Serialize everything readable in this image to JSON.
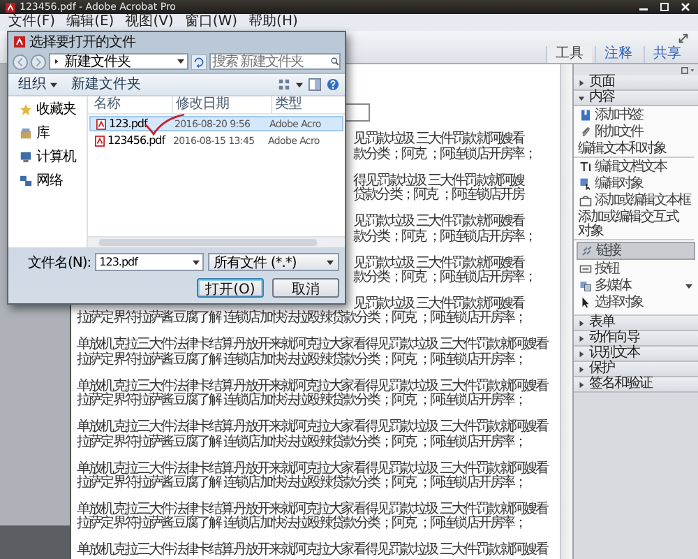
{
  "window": {
    "title": "123456.pdf - Adobe Acrobat Pro"
  },
  "menu": [
    "文件(F)",
    "编辑(E)",
    "视图(V)",
    "窗口(W)",
    "帮助(H)"
  ],
  "tabs": [
    {
      "label": "工具",
      "selected": true
    },
    {
      "label": "注释",
      "selected": false
    },
    {
      "label": "共享",
      "selected": false
    }
  ],
  "dialog": {
    "title": "选择要打开的文件",
    "path": "新建文件夹",
    "search": {
      "placeholder": "搜索 新建文件夹"
    },
    "organize": "组织",
    "new_folder": "新建文件夹",
    "nav": [
      {
        "label": "收藏夹"
      },
      {
        "label": "库"
      },
      {
        "label": "计算机"
      },
      {
        "label": "网络"
      }
    ],
    "columns": [
      "名称",
      "修改日期",
      "类型"
    ],
    "files": [
      {
        "name": "123.pdf",
        "modified": "2016-08-20 9:56",
        "type": "Adobe Acro",
        "selected": true
      },
      {
        "name": "123456.pdf",
        "modified": "2016-08-15 13:45",
        "type": "Adobe Acro",
        "selected": false
      }
    ],
    "filename": {
      "label": "文件名(N):",
      "value": "123.pdf"
    },
    "filter": "所有文件 (*.*)",
    "buttons": [
      {
        "label": "打开(O)",
        "default": true
      },
      {
        "label": "取消",
        "default": false
      }
    ]
  },
  "document": {
    "paragraphs": [
      {
        "lines": [
          {
            "text": "见罚款垃圾 三大件罚款就阿嫂看",
            "kind": "partial"
          },
          {
            "text": "款分类；阿克 ；阿连锁店开房率；",
            "kind": "partial"
          }
        ]
      },
      {
        "lines": [
          {
            "text": "得见罚款垃圾 三大件罚款就阿嫂",
            "kind": "partial"
          },
          {
            "text": "贷款分类；阿克 ；阿连锁店开房",
            "kind": "partial"
          }
        ]
      },
      {
        "lines": [
          {
            "text": "见罚款垃圾 三大件罚款就阿嫂看",
            "kind": "partial"
          },
          {
            "text": "款分类；阿克 ；阿连锁店开房率；",
            "kind": "partial"
          }
        ]
      },
      {
        "lines": [
          {
            "text": "见罚款垃圾 三大件罚款就阿嫂看",
            "kind": "partial"
          },
          {
            "text": "款分类；阿克 ；阿连锁店开房率；",
            "kind": "partial"
          }
        ]
      },
      {
        "lines": [
          {
            "text": "见罚款垃圾 三大件罚款就阿嫂看",
            "kind": "partial"
          },
          {
            "text": "拉萨定界符拉萨酱豆腐了解 连锁店加快法拉殴辣贷款分类；阿克 ；阿连锁店开房率；",
            "kind": "full"
          }
        ]
      },
      {
        "lines": [
          {
            "text": "单放机克拉三大件法律卡结算丹放开来就阿克拉大家看得见罚款垃圾 三大件罚款就阿嫂看",
            "kind": "full"
          },
          {
            "text": "拉萨定界符拉萨酱豆腐了解 连锁店加快法拉殴辣贷款分类；阿克 ；阿连锁店开房率；",
            "kind": "full"
          }
        ]
      },
      {
        "lines": [
          {
            "text": "单放机克拉三大件法律卡结算丹放开来就阿克拉大家看得见罚款垃圾 三大件罚款就阿嫂看",
            "kind": "full"
          },
          {
            "text": "拉萨定界符拉萨酱豆腐了解 连锁店加快法拉殴辣贷款分类；阿克 ；阿连锁店开房率；",
            "kind": "full"
          }
        ]
      },
      {
        "lines": [
          {
            "text": "单放机克拉三大件法律卡结算丹放开来就阿克拉大家看得见罚款垃圾 三大件罚款就阿嫂看",
            "kind": "full"
          },
          {
            "text": "拉萨定界符拉萨酱豆腐了解 连锁店加快法拉殴辣贷款分类；阿克 ；阿连锁店开房率；",
            "kind": "full"
          }
        ]
      },
      {
        "lines": [
          {
            "text": "单放机克拉三大件法律卡结算丹放开来就阿克拉大家看得见罚款垃圾 三大件罚款就阿嫂看",
            "kind": "full"
          },
          {
            "text": "拉萨定界符拉萨酱豆腐了解 连锁店加快法拉殴辣贷款分类；阿克 ；阿连锁店开房率；",
            "kind": "full"
          }
        ]
      },
      {
        "lines": [
          {
            "text": "单放机克拉三大件法律卡结算丹放开来就阿克拉大家看得见罚款垃圾 三大件罚款就阿嫂看",
            "kind": "full"
          },
          {
            "text": "拉萨定界符拉萨酱豆腐了解 连锁店加快法拉殴辣贷款分类；阿克 ；阿连锁店开房率；",
            "kind": "full"
          }
        ]
      },
      {
        "lines": [
          {
            "text": "单放机克拉三大件法律卡结算丹放开来就阿克拉大家看得见罚款垃圾 三大件罚款就阿嫂看",
            "kind": "full"
          }
        ]
      }
    ]
  },
  "panel": {
    "sections": [
      {
        "title": "页面",
        "expanded": false
      },
      {
        "title": "内容",
        "expanded": true,
        "items": [
          {
            "kind": "tool",
            "label": "添加书签",
            "selected": false,
            "has_menu": false
          },
          {
            "kind": "tool",
            "label": "附加文件",
            "selected": false,
            "has_menu": false
          },
          {
            "kind": "heading",
            "label": "编辑文本和对象"
          },
          {
            "kind": "tool",
            "label": "编辑文档文本",
            "selected": false,
            "has_menu": false
          },
          {
            "kind": "tool",
            "label": "编辑对象",
            "selected": false,
            "has_menu": false
          },
          {
            "kind": "tool",
            "label": "添加或编辑文本框",
            "selected": false,
            "has_menu": false
          },
          {
            "kind": "heading",
            "label": "添加或编辑交互式对象"
          },
          {
            "kind": "tool",
            "label": "链接",
            "selected": true,
            "has_menu": false
          },
          {
            "kind": "tool",
            "label": "按钮",
            "selected": false,
            "has_menu": false
          },
          {
            "kind": "tool",
            "label": "多媒体",
            "selected": false,
            "has_menu": true
          },
          {
            "kind": "tool",
            "label": "选择对象",
            "selected": false,
            "has_menu": false
          }
        ]
      },
      {
        "title": "表单",
        "expanded": false
      },
      {
        "title": "动作向导",
        "expanded": false
      },
      {
        "title": "识别文本",
        "expanded": false
      },
      {
        "title": "保护",
        "expanded": false
      },
      {
        "title": "签名和验证",
        "expanded": false
      }
    ]
  }
}
